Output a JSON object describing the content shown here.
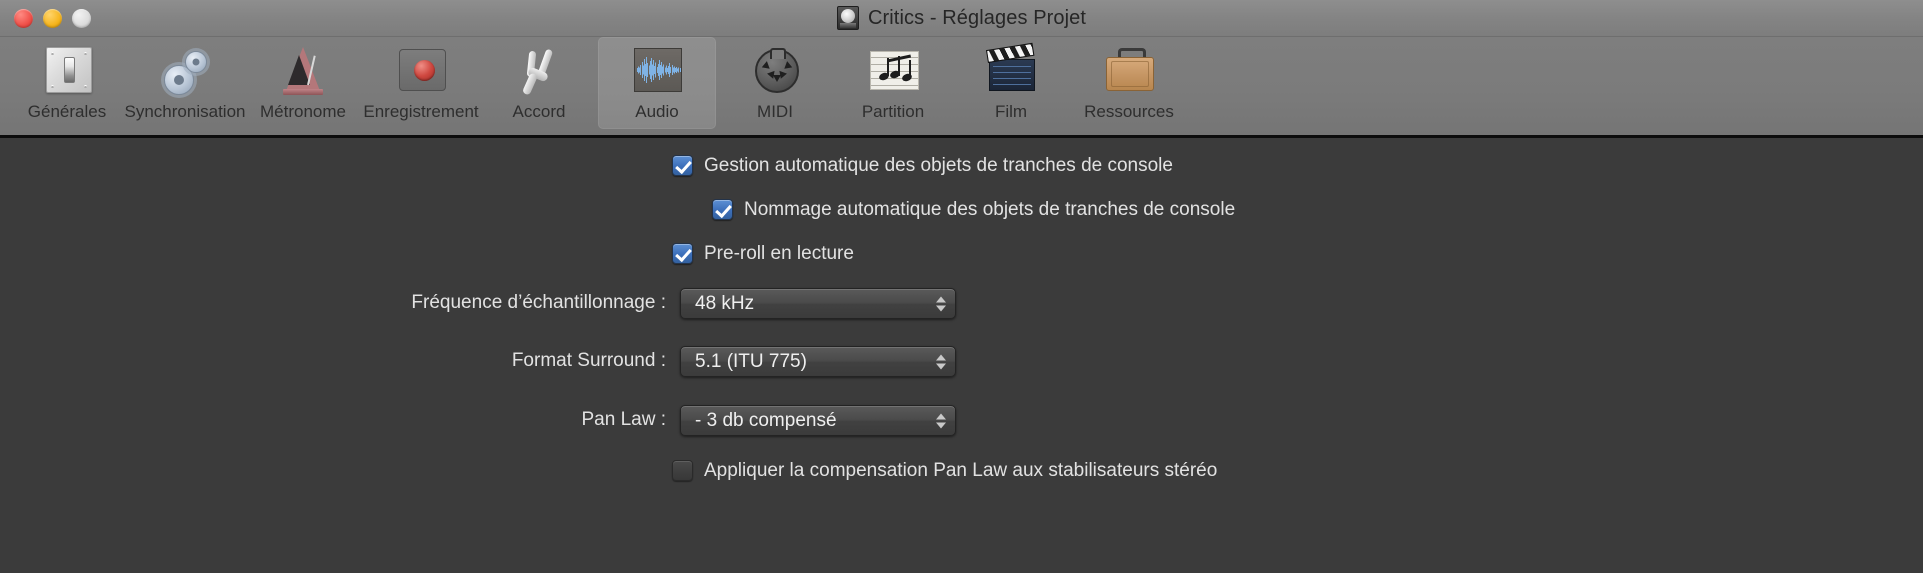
{
  "window": {
    "title": "Critics - Réglages Projet",
    "title_icon": "metronome-disc-icon",
    "traffic_lights": [
      {
        "name": "close",
        "color": "#ef4f48"
      },
      {
        "name": "minimize",
        "color": "#f6b41c"
      },
      {
        "name": "zoom",
        "color": "#dcdcdc"
      }
    ]
  },
  "toolbar": {
    "selected": "Audio",
    "items": [
      {
        "label": "Générales",
        "icon": "switch-plate-icon",
        "selected": false
      },
      {
        "label": "Synchronisation",
        "icon": "gears-icon",
        "selected": false
      },
      {
        "label": "Métronome",
        "icon": "metronome-icon",
        "selected": false
      },
      {
        "label": "Enregistrement",
        "icon": "record-button-icon",
        "selected": false
      },
      {
        "label": "Accord",
        "icon": "tuning-fork-icon",
        "selected": false
      },
      {
        "label": "Audio",
        "icon": "waveform-icon",
        "selected": true
      },
      {
        "label": "MIDI",
        "icon": "midi-din-icon",
        "selected": false
      },
      {
        "label": "Partition",
        "icon": "music-notes-icon",
        "selected": false
      },
      {
        "label": "Film",
        "icon": "clapperboard-icon",
        "selected": false
      },
      {
        "label": "Ressources",
        "icon": "briefcase-icon",
        "selected": false
      }
    ]
  },
  "audio_panel": {
    "checkboxes": [
      {
        "id": "auto-manage-channel-strip-objects",
        "label": "Gestion automatique des objets de tranches de console",
        "checked": true
      },
      {
        "id": "auto-name-channel-strip-objects",
        "label": "Nommage automatique des objets de tranches de console",
        "checked": true
      },
      {
        "id": "playback-preroll",
        "label": "Pre-roll en lecture",
        "checked": true
      },
      {
        "id": "apply-pan-law-to-stereo-balancers",
        "label": "Appliquer la compensation Pan Law aux stabilisateurs stéréo",
        "checked": false
      }
    ],
    "fields": [
      {
        "id": "sample-rate",
        "label": "Fréquence d’échantillonnage :",
        "value": "48 kHz"
      },
      {
        "id": "surround-format",
        "label": "Format Surround :",
        "value": "5.1 (ITU 775)"
      },
      {
        "id": "pan-law",
        "label": "Pan Law :",
        "value": "- 3 db compensé"
      }
    ]
  },
  "colors": {
    "titlebar": "#848484",
    "toolbar": "#7b7b7b",
    "content_background": "#3b3b3b",
    "checkbox_accent": "#3c6fba",
    "text": "#e2e2e2"
  }
}
